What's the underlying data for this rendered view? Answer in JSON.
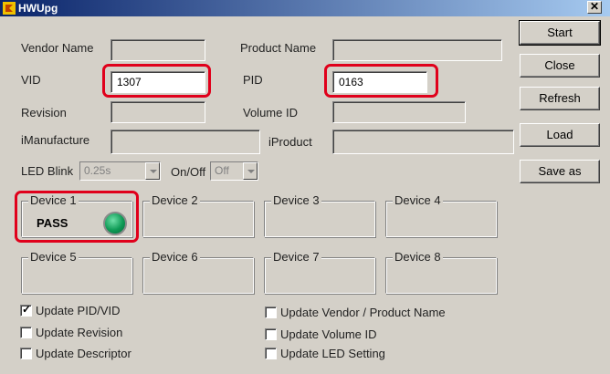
{
  "window": {
    "title": "HWUpg",
    "close_glyph": "✕"
  },
  "labels": {
    "vendor_name": "Vendor Name",
    "product_name": "Product Name",
    "vid": "VID",
    "pid": "PID",
    "revision": "Revision",
    "volume_id": "Volume ID",
    "imanufacture": "iManufacture",
    "iproduct": "iProduct",
    "led_blink": "LED Blink",
    "on_off": "On/Off"
  },
  "values": {
    "vendor_name": "",
    "product_name": "",
    "vid": "1307",
    "pid": "0163",
    "revision": "",
    "volume_id": "",
    "imanufacture": "",
    "iproduct": "",
    "led_blink": "0.25s",
    "on_off": "Off"
  },
  "buttons": {
    "start": "Start",
    "close": "Close",
    "refresh": "Refresh",
    "load": "Load",
    "save_as": "Save as"
  },
  "devices": [
    {
      "label": "Device 1",
      "status": "PASS"
    },
    {
      "label": "Device 2",
      "status": ""
    },
    {
      "label": "Device 3",
      "status": ""
    },
    {
      "label": "Device 4",
      "status": ""
    },
    {
      "label": "Device 5",
      "status": ""
    },
    {
      "label": "Device 6",
      "status": ""
    },
    {
      "label": "Device 7",
      "status": ""
    },
    {
      "label": "Device 8",
      "status": ""
    }
  ],
  "options": {
    "update_pid_vid": {
      "label": "Update PID/VID",
      "checked": true,
      "mark": "✓"
    },
    "update_revision": {
      "label": "Update Revision",
      "checked": false
    },
    "update_descriptor": {
      "label": "Update Descriptor",
      "checked": false
    },
    "update_vendor_product": {
      "label": "Update Vendor / Product Name",
      "checked": false
    },
    "update_volume_id": {
      "label": "Update Volume ID",
      "checked": false
    },
    "update_led_setting": {
      "label": "Update LED Setting",
      "checked": false
    }
  },
  "colors": {
    "highlight": "#e0001b",
    "led_on": "#0e9a55",
    "titlebar": "#0a246a"
  }
}
